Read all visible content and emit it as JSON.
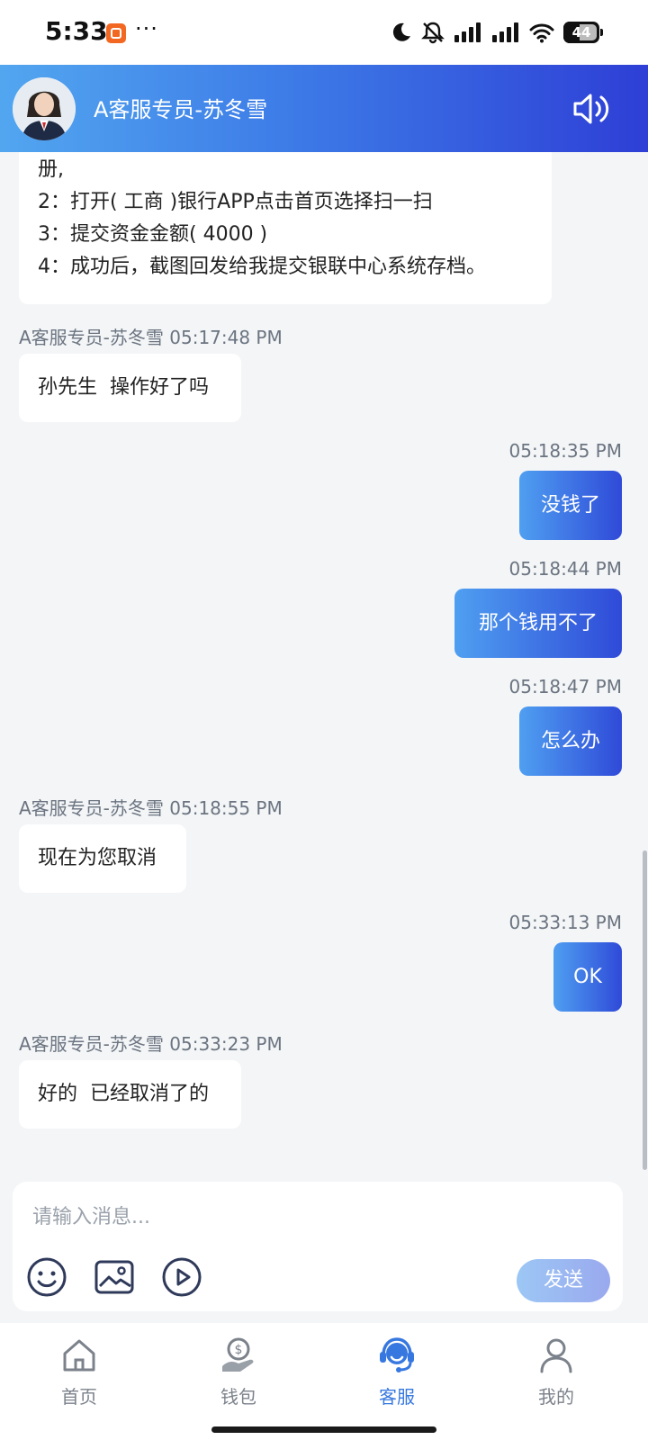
{
  "status_bar": {
    "time": "5:33",
    "dots": "···",
    "battery": "44",
    "icons": [
      "app-notification-icon",
      "moon-icon",
      "bell-muted-icon",
      "signal-icon",
      "signal-icon",
      "wifi-icon",
      "battery-icon"
    ]
  },
  "header": {
    "title": "A客服专员-苏冬雪",
    "avatar": "agent-avatar",
    "speaker_icon": "speaker-icon"
  },
  "messages": [
    {
      "direction": "in",
      "lines": [
        "册,",
        "2：打开( 工商 )银行APP点击首页选择扫一扫",
        "3：提交资金金额( 4000 )",
        "4：成功后，截图回发给我提交银联中心系统存档。"
      ]
    },
    {
      "direction": "in",
      "meta": "A客服专员-苏冬雪 05:17:48 PM",
      "text": "孙先生  操作好了吗"
    },
    {
      "direction": "out",
      "meta": "05:18:35 PM",
      "text": "没钱了"
    },
    {
      "direction": "out",
      "meta": "05:18:44 PM",
      "text": "那个钱用不了"
    },
    {
      "direction": "out",
      "meta": "05:18:47 PM",
      "text": "怎么办"
    },
    {
      "direction": "in",
      "meta": "A客服专员-苏冬雪 05:18:55 PM",
      "text": "现在为您取消"
    },
    {
      "direction": "out",
      "meta": "05:33:13 PM",
      "text": "OK"
    },
    {
      "direction": "in",
      "meta": "A客服专员-苏冬雪 05:33:23 PM",
      "text": "好的  已经取消了的"
    }
  ],
  "composer": {
    "placeholder": "请输入消息...",
    "value": "",
    "send_label": "发送",
    "tools": [
      "emoji-icon",
      "image-icon",
      "video-icon"
    ]
  },
  "bottom_nav": {
    "items": [
      {
        "label": "首页",
        "icon": "home-icon",
        "active": false
      },
      {
        "label": "钱包",
        "icon": "wallet-icon",
        "active": false
      },
      {
        "label": "客服",
        "icon": "customer-service-icon",
        "active": true
      },
      {
        "label": "我的",
        "icon": "profile-icon",
        "active": false
      }
    ]
  },
  "colors": {
    "accent": "#3778e0",
    "header_gradient_start": "#52a6f0",
    "header_gradient_end": "#2e3fd6",
    "background": "#f3f5f7"
  }
}
